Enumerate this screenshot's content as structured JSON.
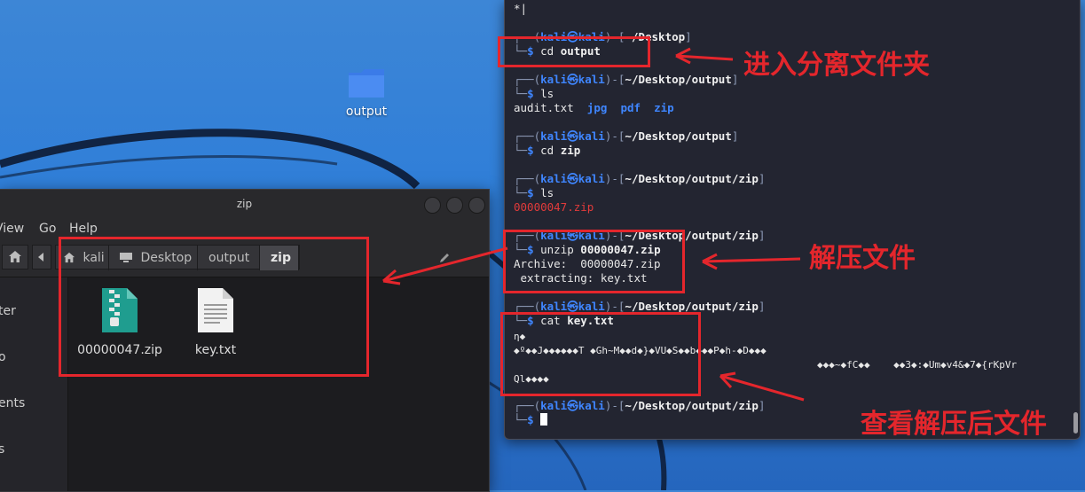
{
  "desktop": {
    "folder_label": "output"
  },
  "file_manager": {
    "title": "zip",
    "menu": [
      "View",
      "Go",
      "Help"
    ],
    "path_crumbs": [
      "kali",
      "Desktop",
      "output",
      "zip"
    ],
    "sidebar": [
      "ter",
      "o",
      "ents",
      "s"
    ],
    "files": [
      {
        "name": "00000047.zip",
        "icon": "zip-archive-icon"
      },
      {
        "name": "key.txt",
        "icon": "text-file-icon"
      }
    ]
  },
  "terminal": {
    "first_line": "*|",
    "prompt": {
      "user": "kali",
      "host": "kali"
    },
    "blocks": [
      {
        "path": "~/Desktop",
        "cmd": "cd",
        "arg": "output"
      },
      {
        "path": "~/Desktop/output",
        "cmd": "ls",
        "arg": ""
      },
      {
        "path": "~/Desktop/output",
        "cmd": "cd",
        "arg": "zip"
      },
      {
        "path": "~/Desktop/output/zip",
        "cmd": "ls",
        "arg": ""
      },
      {
        "path": "~/Desktop/output/zip",
        "cmd": "unzip",
        "arg": "00000047.zip"
      },
      {
        "path": "~/Desktop/output/zip",
        "cmd": "cat",
        "arg": "key.txt"
      },
      {
        "path": "~/Desktop/output/zip",
        "cmd": "",
        "arg": ""
      }
    ],
    "ls_output": {
      "file": "audit.txt",
      "dirs": [
        "jpg",
        "pdf",
        "zip"
      ]
    },
    "ls_zip_output": "00000047.zip",
    "unzip_output": [
      "Archive:  00000047.zip",
      " extracting: key.txt"
    ],
    "cat_output": [
      "η◆",
      "◆º◆◆J◆◆◆◆◆◆T ◆Gh~M◆◆d◆}◆VU◆S◆◆b◆◆◆P◆h-◆D◆◆◆",
      "◆◆◆~◆fC◆◆    ◆◆3◆:◆Um◆v4&◆7◆{rKpVr",
      "Ql◆◆◆◆"
    ]
  },
  "annotations": {
    "enter_folder": "进入分离文件夹",
    "unzip_file": "解压文件",
    "view_unzipped": "查看解压后文件"
  },
  "colors": {
    "annotation_red": "#e4262c",
    "terminal_bg": "#232531",
    "prompt_blue": "#3f86ff",
    "zip_red": "#e13b3b"
  }
}
